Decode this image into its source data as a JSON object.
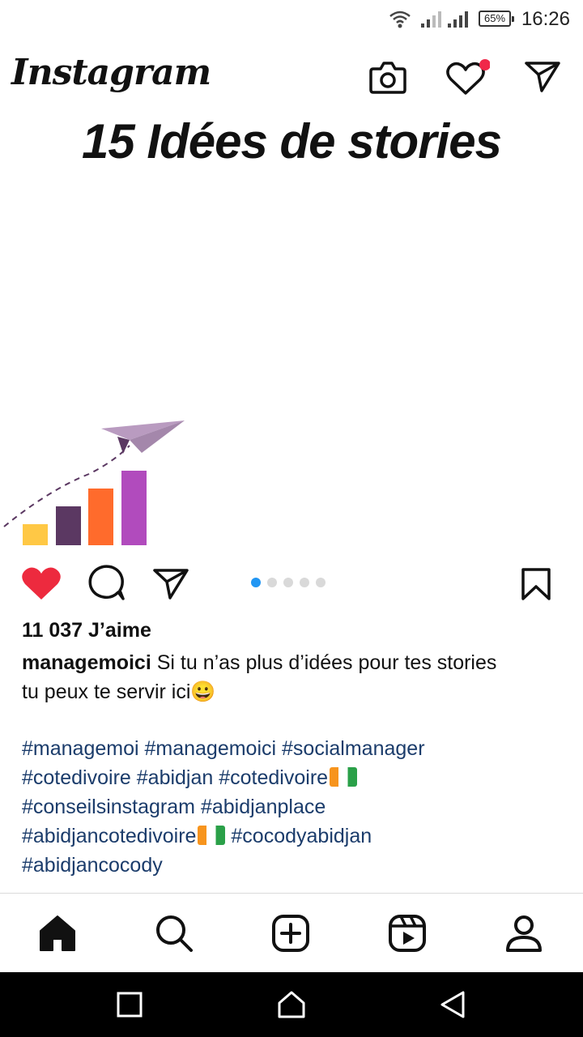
{
  "status_bar": {
    "time": "16:26",
    "battery": "65%"
  },
  "header": {
    "app_name": "Instagram",
    "icons": [
      "camera-icon",
      "heart-icon",
      "send-icon"
    ],
    "notification_dot_color": "#f02849"
  },
  "post": {
    "image_title": "15 Idées de stories",
    "carousel": {
      "count": 5,
      "active_index": 0
    },
    "bar_colors": [
      "#ffc845",
      "#5b3862",
      "#ff6b2c",
      "#b14bbd"
    ],
    "likes": "11 037 J’aime",
    "author": "managemoici",
    "caption_line1": " Si tu n’as plus d’idées pour tes stories",
    "caption_line2": "tu peux te servir ici😀",
    "hashtags": {
      "h1": "#managemoi",
      "h2": "#managemoici",
      "h3": "#socialmanager",
      "h4": "#cotedivoire",
      "h5": "#abidjan",
      "h6": "#cotedivoire",
      "h7": "#conseilsinstagram",
      "h8": "#abidjanplace",
      "h9": "#abidjancotedivoire",
      "h10": "#cocodyabidjan",
      "h11": "#abidjancocody"
    },
    "like_color": "#ed2a3e",
    "hashtag_color": "#1b3c6b"
  },
  "bottom_nav": [
    "home-icon",
    "search-icon",
    "add-post-icon",
    "reels-icon",
    "profile-icon"
  ],
  "system_nav": [
    "recents-icon",
    "home-icon",
    "back-icon"
  ]
}
